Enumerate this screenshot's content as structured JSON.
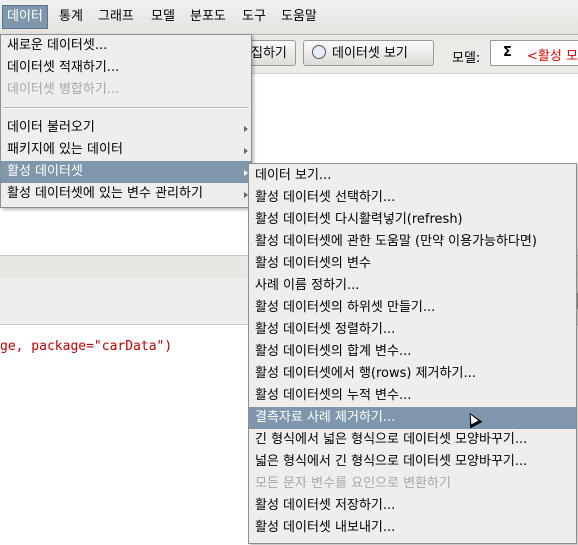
{
  "menubar": {
    "items": [
      "데이터",
      "통계",
      "그래프",
      "모델",
      "분포도",
      "도구",
      "도움말"
    ]
  },
  "toolbar": {
    "edit_label": "집하기",
    "view_label": "데이터셋 보기",
    "model_label": "모델:",
    "model_sigma": "Σ",
    "model_value": "<활성 모"
  },
  "code_line": "ge, package=\"carData\")",
  "data_menu": {
    "items": [
      {
        "label": "새로운 데이터셋...",
        "disabled": false
      },
      {
        "label": "데이터셋 적재하기...",
        "disabled": false
      },
      {
        "label": "데이터셋 병합하기...",
        "disabled": true
      },
      {
        "label": "데이터 불러오기",
        "submenu": true
      },
      {
        "label": "패키지에 있는 데이터",
        "submenu": true
      },
      {
        "label": "활성 데이터셋",
        "submenu": true,
        "highlight": true
      },
      {
        "label": "활성 데이터셋에 있는 변수 관리하기",
        "submenu": true
      }
    ]
  },
  "active_dataset_menu": {
    "items": [
      {
        "label": "데이터 보기..."
      },
      {
        "label": "활성 데이터셋 선택하기..."
      },
      {
        "label": "활성 데이터셋 다시활력넣기(refresh)"
      },
      {
        "label": "활성 데이터셋에 관한 도움말 (만약 이용가능하다면)"
      },
      {
        "label": "활성 데이터셋의 변수"
      },
      {
        "label": "사례 이름 정하기..."
      },
      {
        "label": "활성 데이터셋의 하위셋 만들기..."
      },
      {
        "label": "활성 데이터셋 정렬하기..."
      },
      {
        "label": "활성 데이터셋의 합계 변수..."
      },
      {
        "label": "활성 데이터셋에서 행(rows) 제거하기..."
      },
      {
        "label": "활성 데이터셋의 누적 변수..."
      },
      {
        "label": "결측자료 사례 제거하기...",
        "highlight": true
      },
      {
        "label": "긴 형식에서 넓은 형식으로 데이터셋 모양바꾸기..."
      },
      {
        "label": "넓은 형식에서 긴 형식으로 데이터셋 모양바꾸기..."
      },
      {
        "label": "모든 문자 변수를 요인으로 변환하기",
        "disabled": true
      },
      {
        "label": "활성 데이터셋 저장하기..."
      },
      {
        "label": "활성 데이터셋 내보내기..."
      }
    ]
  },
  "colors": {
    "highlight": "#7f97ad",
    "model_text": "#e00000",
    "code_text": "#c00000"
  }
}
